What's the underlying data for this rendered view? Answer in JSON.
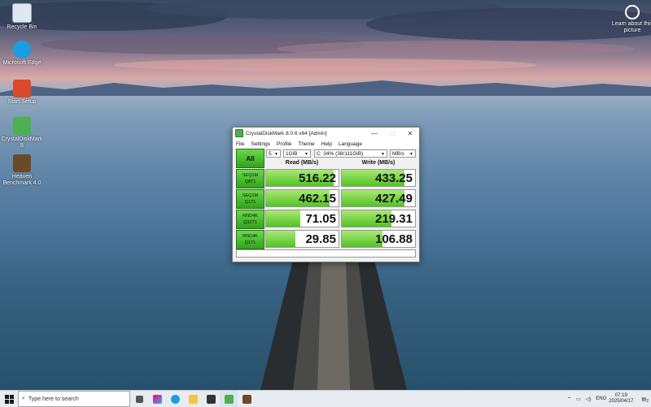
{
  "desktop": {
    "icons": [
      {
        "label": "Recycle Bin",
        "name": "recycle-bin-icon",
        "color": "#dfe8f0"
      },
      {
        "label": "Microsoft Edge",
        "name": "edge-icon",
        "color": "#1b9de2"
      },
      {
        "label": "Start Setup",
        "name": "setup-icon",
        "color": "#d94a2a"
      },
      {
        "label": "CrystalDiskMark 8",
        "name": "crystaldiskmark-icon",
        "color": "#4caf50"
      },
      {
        "label": "Heaven Benchmark 4.0",
        "name": "heaven-benchmark-icon",
        "color": "#6b4a2a"
      }
    ],
    "right_icon": {
      "label": "Learn about this picture",
      "name": "learn-about-picture-icon"
    }
  },
  "window": {
    "title": "CrystalDiskMark 8.0.6 x64 [Admin]",
    "controls": {
      "minimize": "—",
      "maximize": "□",
      "close": "✕"
    },
    "menu": [
      "File",
      "Settings",
      "Profile",
      "Theme",
      "Help",
      "Language"
    ],
    "all_button": "All",
    "count_select": "5",
    "size_select": "1GiB",
    "drive_select": "C: 34% (38/111GiB)",
    "unit_select": "MB/s",
    "read_header": "Read (MB/s)",
    "write_header": "Write (MB/s)",
    "rows": [
      {
        "l1": "SEQ1M",
        "l2": "Q8T1",
        "read": "516.22",
        "write": "433.25",
        "read_frac": 0.93,
        "write_frac": 0.86
      },
      {
        "l1": "SEQ1M",
        "l2": "Q1T1",
        "read": "462.15",
        "write": "427.49",
        "read_frac": 0.88,
        "write_frac": 0.85
      },
      {
        "l1": "RND4K",
        "l2": "Q32T1",
        "read": "71.05",
        "write": "219.31",
        "read_frac": 0.47,
        "write_frac": 0.68
      },
      {
        "l1": "RND4K",
        "l2": "Q1T1",
        "read": "29.85",
        "write": "106.88",
        "read_frac": 0.4,
        "write_frac": 0.55
      }
    ]
  },
  "taskbar": {
    "search_placeholder": "Type here to search",
    "language": "ENG",
    "time": "07:19",
    "date": "2025/04/17",
    "notification_count": "2"
  }
}
